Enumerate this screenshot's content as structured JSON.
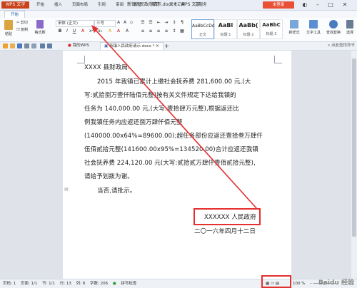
{
  "titlebar": {
    "app_button": "WPS 文字",
    "menus": [
      "开始",
      "插入",
      "页面布局",
      "引用",
      "审阅",
      "视图",
      "章节",
      "开发工具",
      "云服务"
    ],
    "doc_title": "新镇人民政府请示.docx * - WPS 文字",
    "login": "未登录"
  },
  "ribbon": {
    "cut": "剪切",
    "copy": "复制",
    "format_painter": "格式刷",
    "paste": "粘贴",
    "font_name": "宋体 (正文)",
    "font_size": "三号",
    "styles": [
      {
        "sample": "AaBbCcDd",
        "name": "正文"
      },
      {
        "sample": "AaBl",
        "name": "标题 1"
      },
      {
        "sample": "AaBb(",
        "name": "标题 2"
      },
      {
        "sample": "AaBbC",
        "name": "标题 3"
      }
    ],
    "new_style": "新样式",
    "text_tools": "文字工具",
    "find_replace": "查找替换",
    "select": "选择"
  },
  "doc_tabs": {
    "tab1": "我的WPS",
    "tab2": "新镇人民政府请示.docx *",
    "hint": "点此查找命令"
  },
  "document": {
    "lines": [
      "XXXX 县财政局:",
      "2015 年我镇已累计上缴社会抚养费 281,600.00 元,(大",
      "写:贰拾捌万壹仟陆佰元整)按有关文件规定下达给我镇的",
      "任务为 140,000.00 元,(大写:壹拾肆万元整),根据返还比",
      "例我镇任务内应返还捌万肆仟佰元整",
      "(140000.00x64%=89600.00);超任务部份应返还壹拾叁万肆仟",
      "伍佰贰拾元整(141600.00x95%=134520.00)合计应返还我镇",
      "社会抚养费 224,120.00 元(大写:贰拾贰万肆仟壹佰贰拾元整),",
      "请给予划拨为谢。",
      "当否,请批示。"
    ],
    "signature": "XXXXXX 人民政府",
    "date": "二〇一六年四月十二日"
  },
  "status": {
    "page": "页码: 1",
    "pages": "页面: 1/1",
    "section": "节: 1/1",
    "row": "行: 13",
    "col": "列: 8",
    "words": "字数: 206",
    "spell": "拼写检查",
    "zoom": "100 %"
  },
  "watermark": "Baidu 经验"
}
